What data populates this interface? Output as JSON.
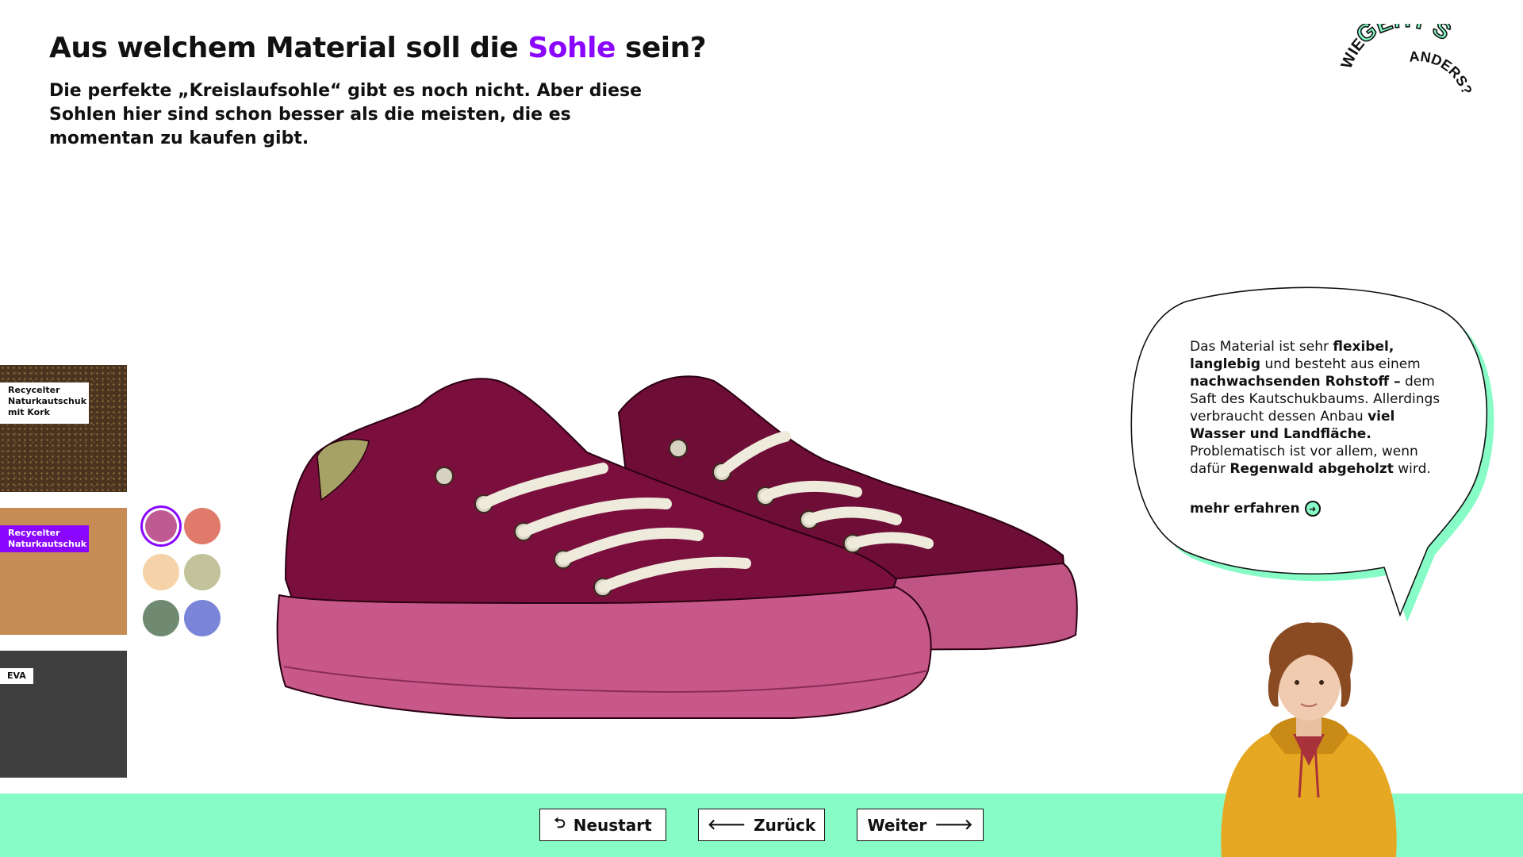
{
  "header": {
    "title_before": "Aus welchem Material soll die",
    "title_accent": "Sohle",
    "title_after": "sein?",
    "subtitle": "Die perfekte „Kreislaufsohle“ gibt es noch nicht. Aber diese Sohlen hier sind schon besser als die meisten, die es momentan zu kaufen gibt."
  },
  "logo": {
    "line1": "WIE",
    "line2": "GEHT'S",
    "line3": "ANDERS?"
  },
  "materials": [
    {
      "label": "Recycelter Naturkautschuk mit Kork",
      "selected": false
    },
    {
      "label": "Recycelter Naturkautschuk",
      "selected": true
    },
    {
      "label": "EVA",
      "selected": false
    }
  ],
  "colors": {
    "accent": "#8a06ff",
    "mint": "#87fcc6",
    "upper": "#7a0f3d",
    "sole": "#c8578a",
    "swatches": [
      "#c05a93",
      "#e07a6a",
      "#f5d2a8",
      "#c2c39a",
      "#708a72",
      "#7b85d8"
    ],
    "selected_swatch": 0
  },
  "bubble": {
    "t1": "Das Material ist sehr ",
    "b1": "flexibel, langlebig",
    "t2": " und besteht aus einem ",
    "b2": "nachwachsenden Rohstoff –",
    "t3": " dem Saft des Kautschukbaums. Allerdings verbraucht dessen Anbau ",
    "b3": "viel Wasser und Landfläche.",
    "t4": " Problematisch ist vor allem, wenn dafür ",
    "b4": "Regenwald abgeholzt",
    "t5": " wird.",
    "more": "mehr erfahren"
  },
  "footer": {
    "restart": "Neustart",
    "back": "Zurück",
    "next": "Weiter"
  }
}
